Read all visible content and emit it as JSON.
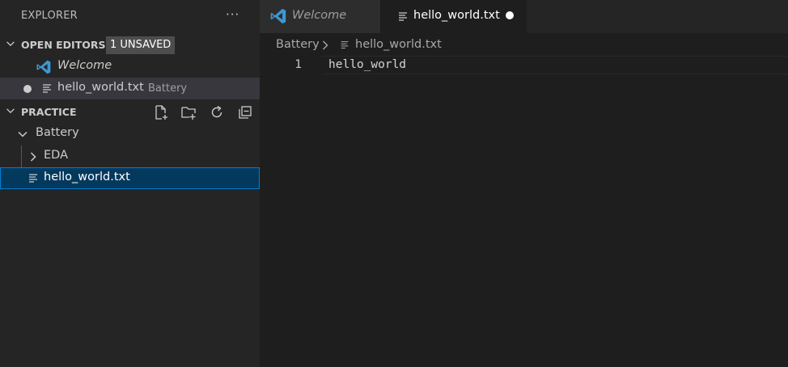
{
  "sidebar": {
    "title": "EXPLORER",
    "more_actions": "···",
    "open_editors": {
      "title": "OPEN EDITORS",
      "badge": "1 UNSAVED",
      "items": [
        {
          "name": "Welcome",
          "description": "",
          "icon": "vscode-logo-icon",
          "dirty": false
        },
        {
          "name": "hello_world.txt",
          "description": "Battery",
          "icon": "text-file-icon",
          "dirty": true
        }
      ]
    },
    "workspace": {
      "title": "PRACTICE",
      "actions": [
        "new-file-icon",
        "new-folder-icon",
        "refresh-icon",
        "collapse-all-icon"
      ],
      "tree": [
        {
          "label": "Battery",
          "type": "folder",
          "expanded": true
        },
        {
          "label": "EDA",
          "type": "folder",
          "expanded": false
        },
        {
          "label": "hello_world.txt",
          "type": "file",
          "selected": true
        }
      ]
    }
  },
  "tabs": [
    {
      "label": "Welcome",
      "icon": "vscode-logo-icon",
      "active": false
    },
    {
      "label": "hello_world.txt",
      "icon": "text-file-icon",
      "active": true,
      "dirty": true
    }
  ],
  "breadcrumb": {
    "folder": "Battery",
    "file": "hello_world.txt"
  },
  "editor": {
    "lines": [
      {
        "number": "1",
        "text": "hello_world"
      }
    ]
  },
  "colors": {
    "selection_background": "#04395e",
    "selection_border": "#007fd4",
    "badge_background": "#4d4d4d",
    "vscode_blue": "#3c99d4"
  }
}
